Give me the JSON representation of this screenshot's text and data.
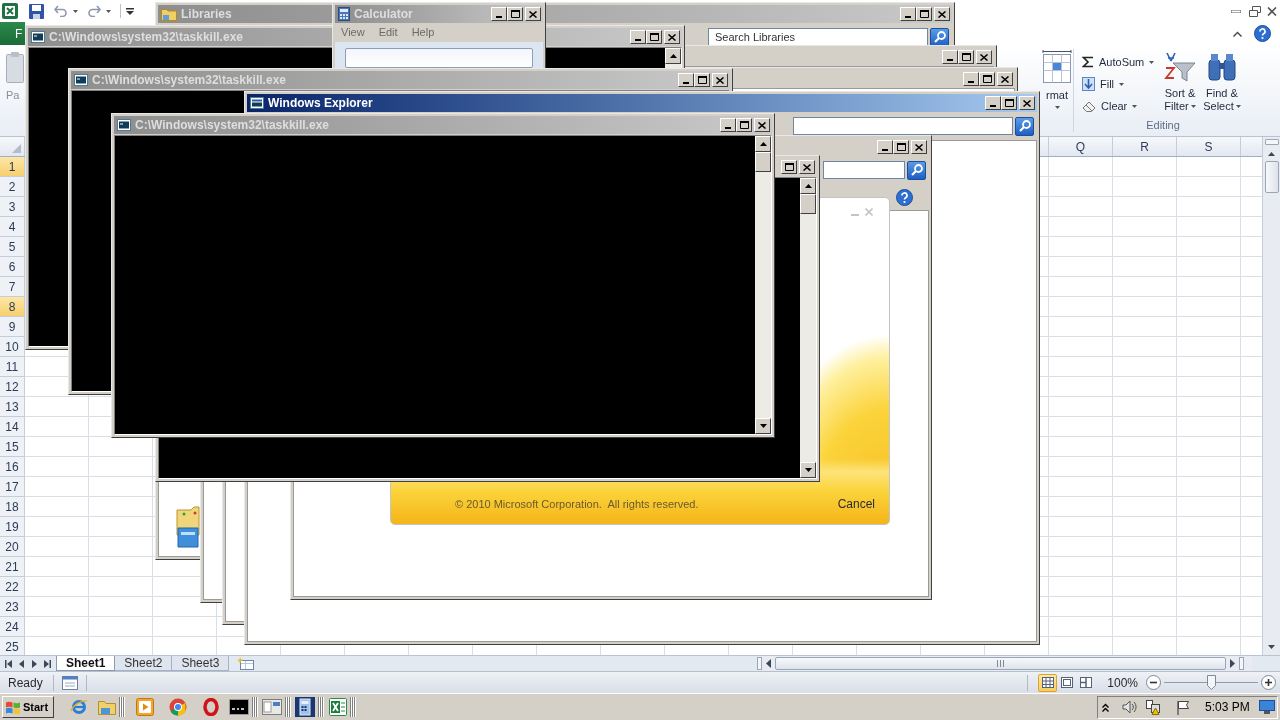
{
  "excel": {
    "file_tab": "F",
    "ribbon": {
      "paste_label": "Pa",
      "format_label": "rmat",
      "autosum_label": "AutoSum",
      "fill_label": "Fill",
      "clear_label": "Clear",
      "sort_filter_lines": [
        "Sort &",
        "Filter"
      ],
      "find_select_lines": [
        "Find &",
        "Select"
      ],
      "group_label": "Editing"
    },
    "columns": [
      {
        "label": "Q"
      },
      {
        "label": "R"
      },
      {
        "label": "S"
      }
    ],
    "rows": [
      {
        "label": "1",
        "selected": true
      },
      {
        "label": "2",
        "selected": false
      },
      {
        "label": "3",
        "selected": false
      },
      {
        "label": "4",
        "selected": false
      },
      {
        "label": "5",
        "selected": false
      },
      {
        "label": "6",
        "selected": false
      },
      {
        "label": "7",
        "selected": false
      },
      {
        "label": "8",
        "selected": true
      },
      {
        "label": "9",
        "selected": false
      },
      {
        "label": "10",
        "selected": false
      },
      {
        "label": "11",
        "selected": false
      },
      {
        "label": "12",
        "selected": false
      },
      {
        "label": "13",
        "selected": false
      },
      {
        "label": "14",
        "selected": false
      },
      {
        "label": "15",
        "selected": false
      },
      {
        "label": "16",
        "selected": false
      },
      {
        "label": "17",
        "selected": false
      },
      {
        "label": "18",
        "selected": false
      },
      {
        "label": "19",
        "selected": false
      },
      {
        "label": "20",
        "selected": false
      },
      {
        "label": "21",
        "selected": false
      },
      {
        "label": "22",
        "selected": false
      },
      {
        "label": "23",
        "selected": false
      },
      {
        "label": "24",
        "selected": false
      },
      {
        "label": "25",
        "selected": false
      }
    ],
    "sheet_tabs": [
      {
        "label": "Sheet1",
        "selected": true
      },
      {
        "label": "Sheet2",
        "selected": false
      },
      {
        "label": "Sheet3",
        "selected": false
      }
    ],
    "status_bar": {
      "text": "Ready",
      "views": [
        {
          "kind": "normal",
          "selected": true
        },
        {
          "kind": "page_layout",
          "selected": false
        },
        {
          "kind": "page_break",
          "selected": false
        }
      ],
      "zoom": {
        "reading": "100%",
        "level": 0.5
      }
    }
  },
  "windows": [
    {
      "kind": "library",
      "title": "Libraries",
      "active": false,
      "search_field": {
        "placeholder": "Search Libraries"
      },
      "nav_icon": true
    },
    {
      "kind": "explorer"
    },
    {
      "kind": "explorer"
    },
    {
      "kind": "console",
      "title": "C:\\Windows\\system32\\taskkill.exe",
      "active": false,
      "scrollbar": true
    },
    {
      "kind": "calculator",
      "title": "Calculator",
      "active": false,
      "menu": [
        "View",
        "Edit",
        "Help"
      ]
    },
    {
      "kind": "console",
      "title": "C:\\Windows\\system32\\taskkill.exe",
      "active": false,
      "scrollbar": false
    },
    {
      "kind": "explorer",
      "title": "Windows Explorer",
      "active": true,
      "search_field": true
    },
    {
      "kind": "explorer",
      "search_field": true,
      "help_button": true
    },
    {
      "kind": "splash",
      "copyright": "© 2010 Microsoft Corporation.  All rights reserved.",
      "button": "Cancel"
    },
    {
      "kind": "console",
      "scrollbar": true,
      "controls": [
        {
          "kind": "maximize"
        },
        {
          "kind": "close"
        }
      ]
    },
    {
      "kind": "console",
      "title": "C:\\Windows\\system32\\taskkill.exe",
      "active": false,
      "scrollbar": true
    }
  ],
  "taskbar": {
    "start": "Start",
    "items": [
      {
        "kind": "browser_e",
        "stacked": false
      },
      {
        "kind": "folder",
        "stacked": true
      },
      {
        "kind": "media",
        "stacked": false
      },
      {
        "kind": "browser_round",
        "stacked": false
      },
      {
        "kind": "browser_ring",
        "stacked": false
      },
      {
        "kind": "console",
        "stacked": true
      },
      {
        "kind": "window",
        "stacked": true
      },
      {
        "kind": "calculator",
        "stacked": true
      },
      {
        "kind": "spreadsheet",
        "stacked": true
      }
    ],
    "clock": "5:03 PM"
  }
}
